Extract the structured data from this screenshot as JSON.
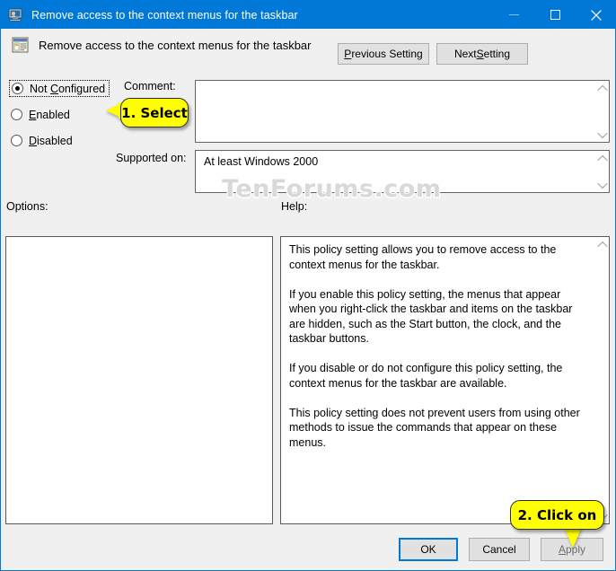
{
  "window": {
    "title": "Remove access to the context menus for the taskbar",
    "icon": "computer-policy-icon",
    "controls": {
      "minimize": "minimize-icon",
      "maximize": "maximize-icon",
      "close": "close-icon"
    },
    "accent_color": "#0078d7",
    "face_color": "#f0f0f0"
  },
  "header": {
    "icon": "policy-setting-icon",
    "title": "Remove access to the context menus for the taskbar",
    "previous_setting": "Previous Setting",
    "next_setting": "Next Setting"
  },
  "state_options": [
    {
      "label": "Not Configured",
      "selected": true,
      "focused": true
    },
    {
      "label": "Enabled",
      "selected": false,
      "focused": false
    },
    {
      "label": "Disabled",
      "selected": false,
      "focused": false
    }
  ],
  "comment": {
    "label": "Comment:",
    "value": "",
    "scroll_up_icon": "chevron-up-icon",
    "scroll_down_icon": "chevron-down-icon"
  },
  "supported_on": {
    "label": "Supported on:",
    "value": "At least Windows 2000",
    "scroll_up_icon": "chevron-up-icon",
    "scroll_down_icon": "chevron-down-icon"
  },
  "options": {
    "label": "Options:",
    "content": ""
  },
  "help": {
    "label": "Help:",
    "text": "This policy setting allows you to remove access to the context menus for the taskbar.\n\nIf you enable this policy setting, the menus that appear when you right-click the taskbar and items on the taskbar are hidden, such as the Start button, the clock, and the taskbar buttons.\n\nIf you disable or do not configure this policy setting, the context menus for the taskbar are available.\n\nThis policy setting does not prevent users from using other methods to issue the commands that appear on these menus.",
    "scroll_up_icon": "chevron-up-icon",
    "scroll_down_icon": "chevron-down-icon"
  },
  "footer": {
    "ok": "OK",
    "cancel": "Cancel",
    "apply": "Apply",
    "apply_disabled": true
  },
  "watermark": "TenForums.com",
  "annotations": [
    {
      "id": "step-1",
      "text": "1. Select",
      "color": "#ffff00",
      "points": "left"
    },
    {
      "id": "step-2",
      "text": "2. Click on",
      "color": "#ffff00",
      "points": "down"
    }
  ]
}
